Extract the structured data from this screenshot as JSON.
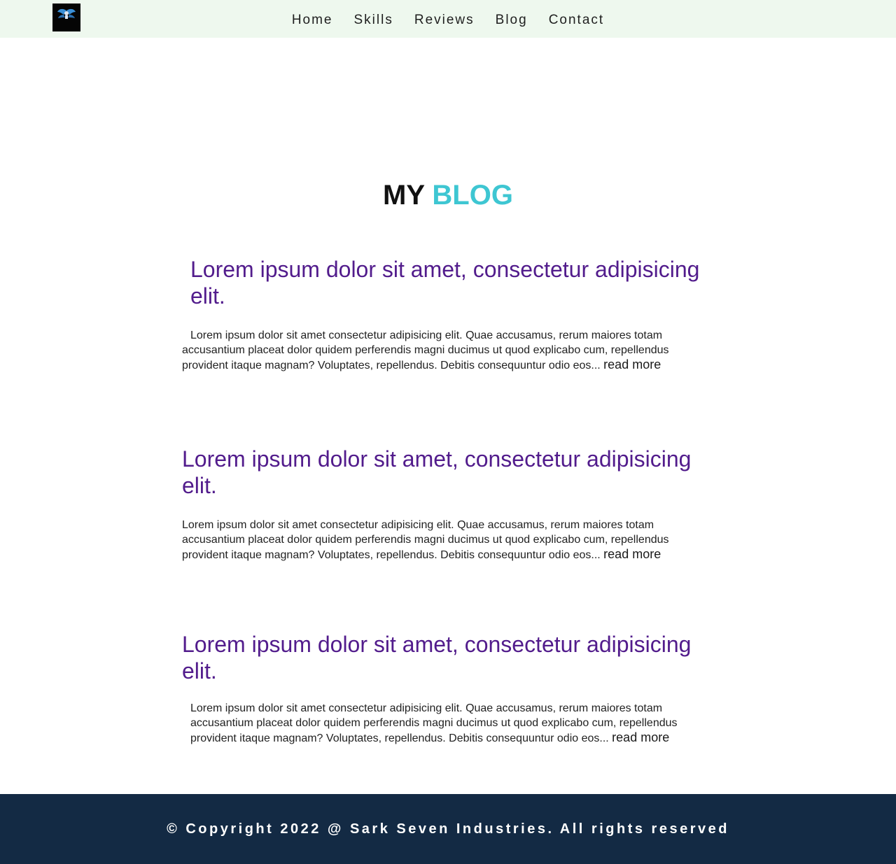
{
  "nav": {
    "logo_alt": "SARK7",
    "links": [
      "Home",
      "Skills",
      "Reviews",
      "Blog",
      "Contact"
    ]
  },
  "heading": {
    "part1": "MY",
    "part2": "BLOG"
  },
  "posts": [
    {
      "title": "Lorem ipsum dolor sit amet, consectetur adipisicing elit.",
      "body": "Lorem ipsum dolor sit amet consectetur adipisicing elit. Quae accusamus, rerum maiores totam accusantium placeat dolor quidem perferendis magni ducimus ut quod explicabo cum, repellendus provident itaque magnam? Voluptates, repellendus. Debitis consequuntur odio eos...",
      "read_more": "read more"
    },
    {
      "title": "Lorem ipsum dolor sit amet, consectetur adipisicing elit.",
      "body": "Lorem ipsum dolor sit amet consectetur adipisicing elit. Quae accusamus, rerum maiores totam accusantium placeat dolor quidem perferendis magni ducimus ut quod explicabo cum, repellendus provident itaque magnam? Voluptates, repellendus. Debitis consequuntur odio eos...",
      "read_more": "read more"
    },
    {
      "title": "Lorem ipsum dolor sit amet, consectetur adipisicing elit.",
      "body": "Lorem ipsum dolor sit amet consectetur adipisicing elit. Quae accusamus, rerum maiores totam accusantium placeat dolor quidem perferendis magni ducimus ut quod explicabo cum, repellendus provident itaque magnam? Voluptates, repellendus. Debitis consequuntur odio eos...",
      "read_more": "read more"
    }
  ],
  "footer": {
    "text": "© Copyright 2022 @ Sark Seven Industries. All rights reserved"
  },
  "colors": {
    "nav_bg": "#eef8ee",
    "accent": "#3ec6d2",
    "post_title": "#521c8c",
    "footer_bg": "#132a44"
  }
}
